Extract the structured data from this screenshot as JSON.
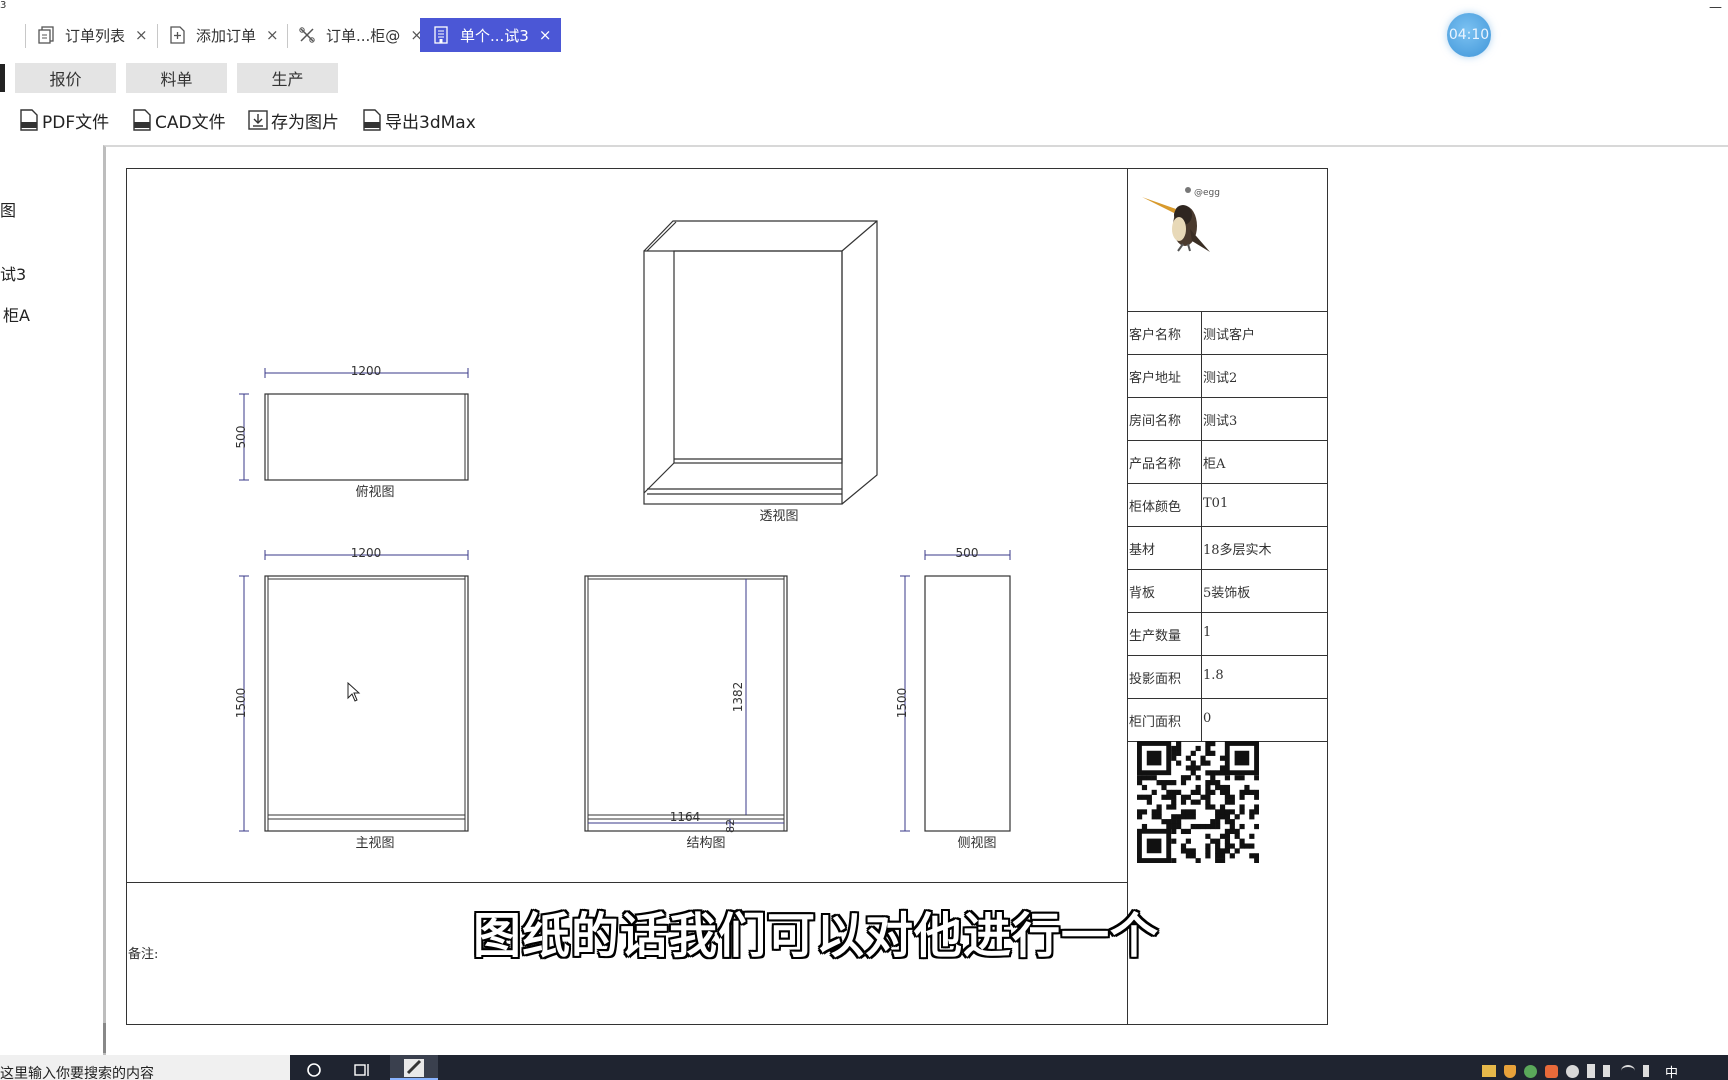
{
  "window": {
    "corner_mark": "3",
    "minimize": "—",
    "timer": "04:10"
  },
  "tabs": [
    {
      "label": "订单列表",
      "close": "×",
      "icon": "document-list-icon"
    },
    {
      "label": "添加订单",
      "close": "×",
      "icon": "add-document-icon"
    },
    {
      "label": "订单...柜@",
      "close": "×",
      "icon": "tools-icon"
    },
    {
      "label": "单个...试3",
      "close": "×",
      "icon": "building-icon",
      "active": true
    }
  ],
  "segments": [
    "报价",
    "料单",
    "生产"
  ],
  "toolbar": [
    {
      "label": "PDF文件",
      "icon": "pdf-file-icon"
    },
    {
      "label": "CAD文件",
      "icon": "cad-file-icon"
    },
    {
      "label": "存为图片",
      "icon": "download-icon"
    },
    {
      "label": "导出3dMax",
      "icon": "export-file-icon"
    }
  ],
  "left_panel": [
    "图",
    "试3",
    "柜A"
  ],
  "drawing": {
    "top_view": {
      "caption": "俯视图",
      "width_dim": "1200",
      "depth_dim": "500"
    },
    "perspective": {
      "caption": "透视图"
    },
    "front_view": {
      "caption": "主视图",
      "width_dim": "1200",
      "height_dim": "1500"
    },
    "structure_view": {
      "caption": "结构图",
      "inner_height_dim": "1382",
      "inner_width_dim": "1164",
      "plinth_dim": "82"
    },
    "side_view": {
      "caption": "侧视图",
      "depth_dim": "500",
      "height_dim": "1500"
    }
  },
  "remarks_label": "备注:",
  "logo_text": "@egg",
  "info": [
    {
      "key": "客户名称",
      "value": "测试客户"
    },
    {
      "key": "客户地址",
      "value": "测试2"
    },
    {
      "key": "房间名称",
      "value": "测试3"
    },
    {
      "key": "产品名称",
      "value": "柜A"
    },
    {
      "key": "柜体颜色",
      "value": "T01"
    },
    {
      "key": "基材",
      "value": "18多层实木"
    },
    {
      "key": "背板",
      "value": "5装饰板"
    },
    {
      "key": "生产数量",
      "value": "1"
    },
    {
      "key": "投影面积",
      "value": "1.8"
    },
    {
      "key": "柜门面积",
      "value": "0"
    }
  ],
  "subtitle": "图纸的话我们可以对他进行一个",
  "taskbar": {
    "search_placeholder": "这里输入你要搜索的内容",
    "tray_time": "中"
  }
}
